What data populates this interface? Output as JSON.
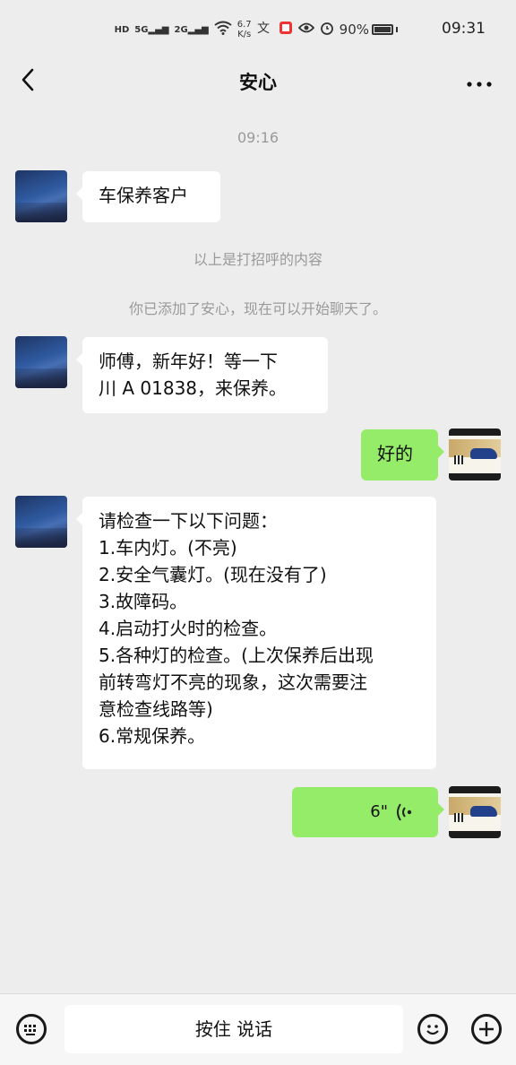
{
  "status_bar": {
    "hd": "HD",
    "signal1": "5G",
    "signal2": "2G",
    "speed_value": "6.7",
    "speed_unit": "K/s",
    "battery": "90%",
    "time": "09:31"
  },
  "navbar": {
    "title": "安心"
  },
  "chat": {
    "timestamp": "09:16",
    "messages": {
      "m1": "车保养客户",
      "system1": "以上是打招呼的内容",
      "system2": "你已添加了安心，现在可以开始聊天了。",
      "m2": [
        "师傅，新年好！等一下",
        "川 A 01838，来保养。"
      ],
      "m3": "好的",
      "m4": [
        "请检查一下以下问题：",
        "1.车内灯。(不亮)",
        "2.安全气囊灯。(现在没有了)",
        "3.故障码。",
        "4.启动打火时的检查。",
        "5.各种灯的检查。(上次保养后出现",
        "前转弯灯不亮的现象，这次需要注",
        "意检查线路等)",
        "6.常规保养。"
      ],
      "voice_duration": "6\""
    }
  },
  "bottom_bar": {
    "hold_to_talk": "按住 说话"
  },
  "colors": {
    "background": "#ededed",
    "bubble_self": "#95ec69",
    "bubble_other": "#ffffff"
  }
}
